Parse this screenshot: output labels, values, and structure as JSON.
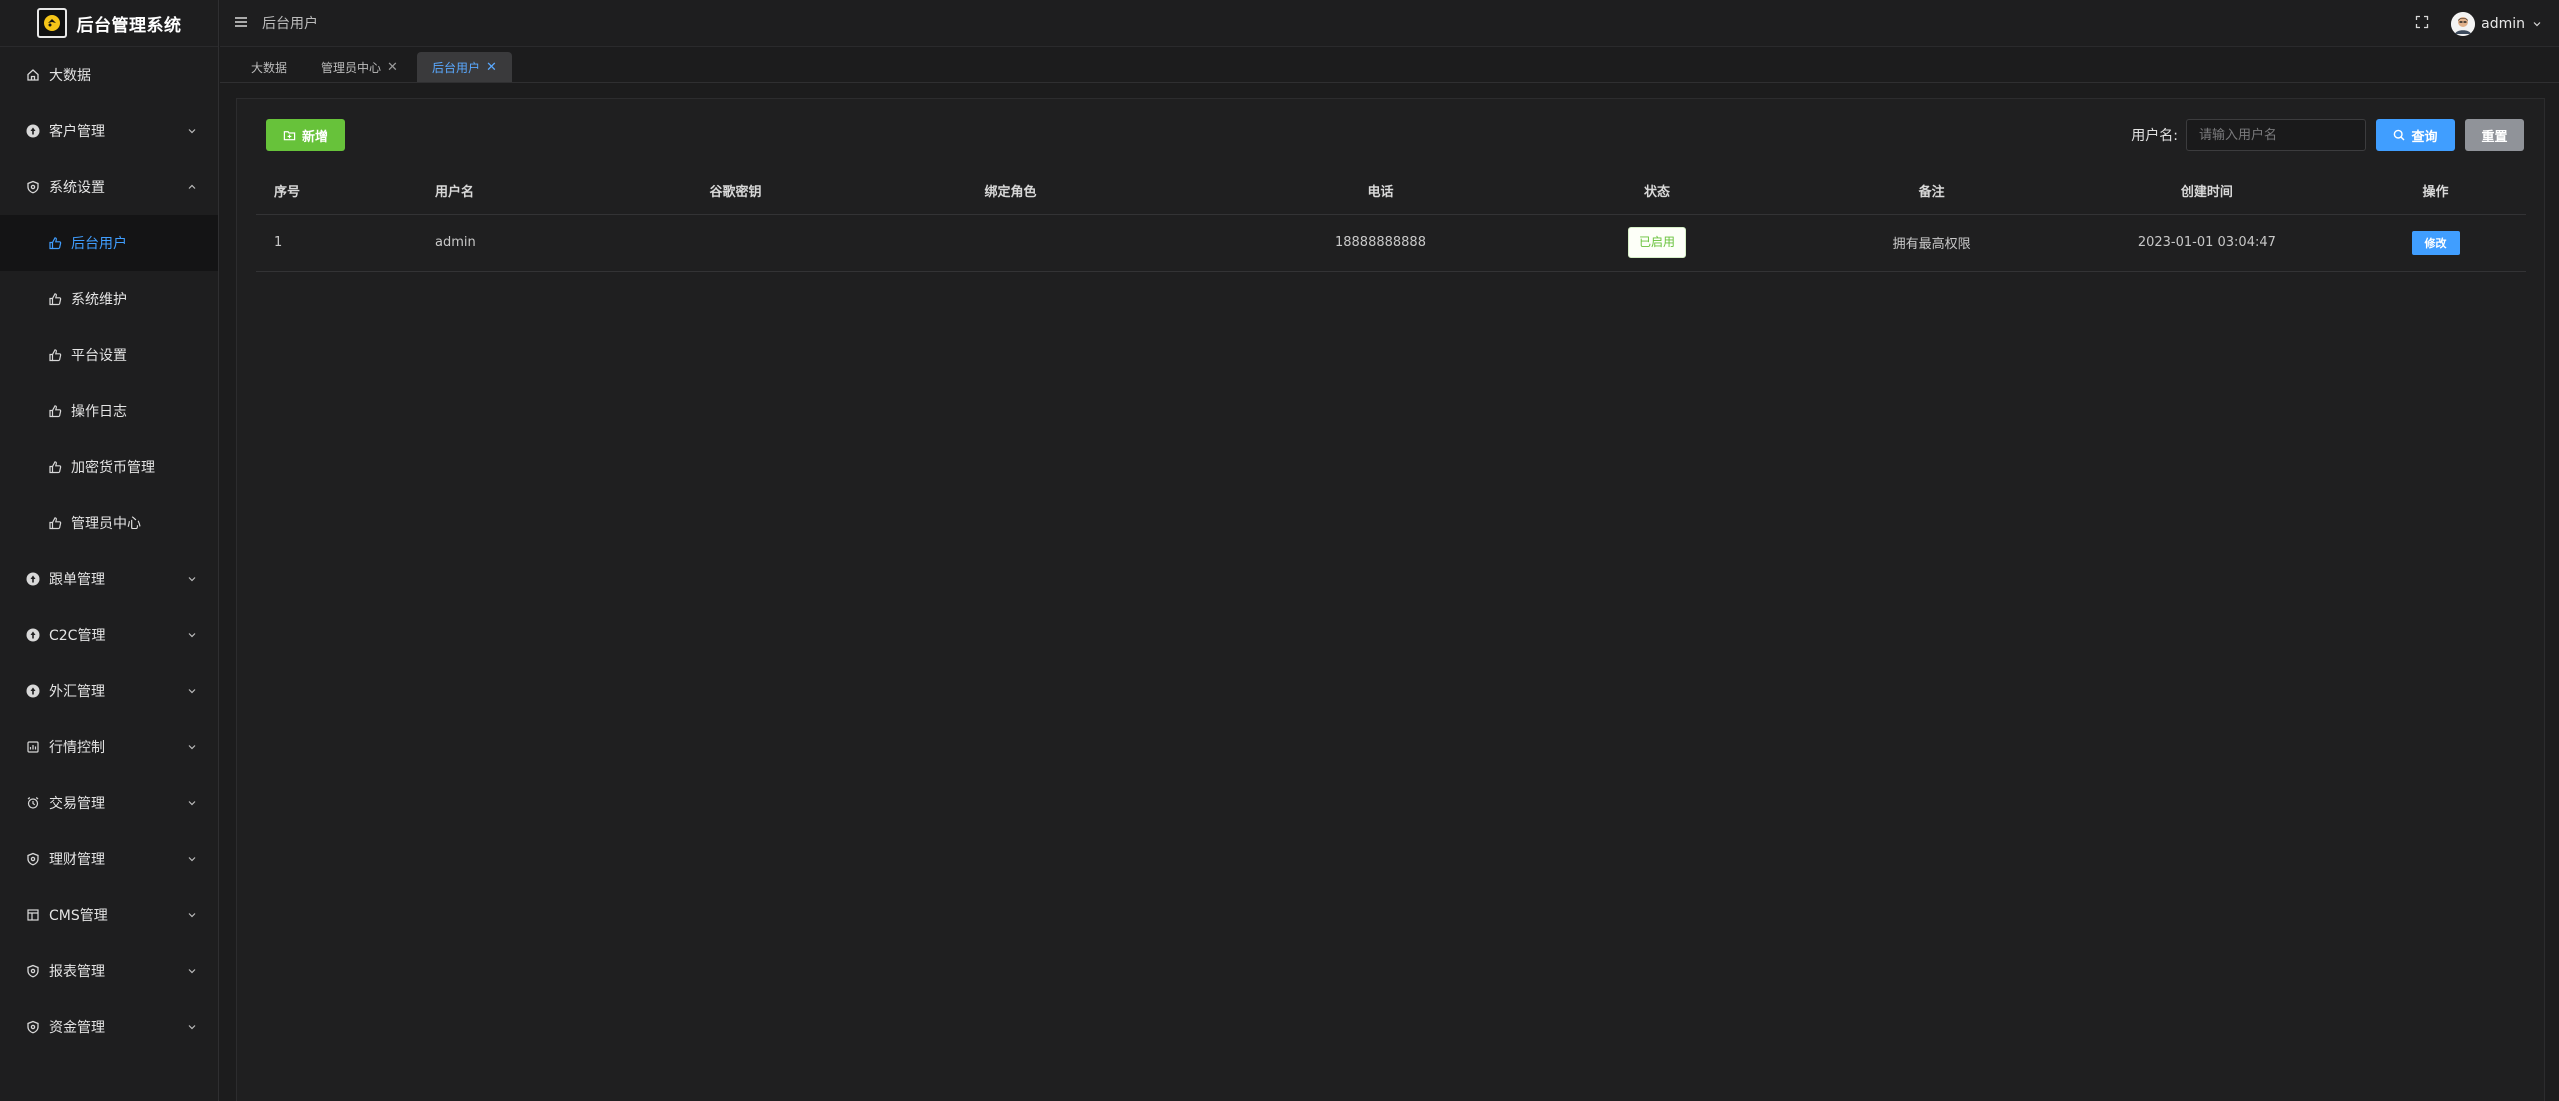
{
  "app": {
    "title": "后台管理系统"
  },
  "sidebar": {
    "items": [
      {
        "label": "大数据",
        "icon": "home-icon",
        "expandable": false
      },
      {
        "label": "客户管理",
        "icon": "upload-circle-icon",
        "expandable": true,
        "expanded": false
      },
      {
        "label": "系统设置",
        "icon": "shield-icon",
        "expandable": true,
        "expanded": true,
        "children": [
          {
            "label": "后台用户",
            "icon": "thumb-icon",
            "active": true
          },
          {
            "label": "系统维护",
            "icon": "thumb-icon"
          },
          {
            "label": "平台设置",
            "icon": "thumb-icon"
          },
          {
            "label": "操作日志",
            "icon": "thumb-icon"
          },
          {
            "label": "加密货币管理",
            "icon": "thumb-icon"
          },
          {
            "label": "管理员中心",
            "icon": "thumb-icon"
          }
        ]
      },
      {
        "label": "跟单管理",
        "icon": "upload-circle-icon",
        "expandable": true
      },
      {
        "label": "C2C管理",
        "icon": "upload-circle-icon",
        "expandable": true
      },
      {
        "label": "外汇管理",
        "icon": "upload-circle-icon",
        "expandable": true
      },
      {
        "label": "行情控制",
        "icon": "chart-box-icon",
        "expandable": true
      },
      {
        "label": "交易管理",
        "icon": "alarm-clock-icon",
        "expandable": true
      },
      {
        "label": "理财管理",
        "icon": "shield-icon",
        "expandable": true
      },
      {
        "label": "CMS管理",
        "icon": "layout-icon",
        "expandable": true
      },
      {
        "label": "报表管理",
        "icon": "shield-icon",
        "expandable": true
      },
      {
        "label": "资金管理",
        "icon": "shield-icon",
        "expandable": true
      }
    ]
  },
  "header": {
    "breadcrumb": "后台用户",
    "user_name": "admin"
  },
  "tabs": [
    {
      "label": "大数据",
      "closable": false,
      "active": false
    },
    {
      "label": "管理员中心",
      "closable": true,
      "active": false
    },
    {
      "label": "后台用户",
      "closable": true,
      "active": true
    }
  ],
  "toolbar": {
    "add_label": "新增",
    "search_label": "用户名:",
    "search_placeholder": "请输入用户名",
    "search_value": "",
    "query_label": "查询",
    "reset_label": "重置"
  },
  "table": {
    "columns": [
      "序号",
      "用户名",
      "谷歌密钥",
      "绑定角色",
      "电话",
      "状态",
      "备注",
      "创建时间",
      "操作"
    ],
    "rows": [
      {
        "index": "1",
        "username": "admin",
        "google_key": "",
        "role": "",
        "phone": "18888888888",
        "status": "已启用",
        "remark": "拥有最高权限",
        "created": "2023-01-01 03:04:47",
        "action": "修改"
      }
    ]
  },
  "colors": {
    "accent": "#409eff",
    "success": "#67c23a",
    "neutral": "#909399",
    "background": "#1c1c1d"
  }
}
